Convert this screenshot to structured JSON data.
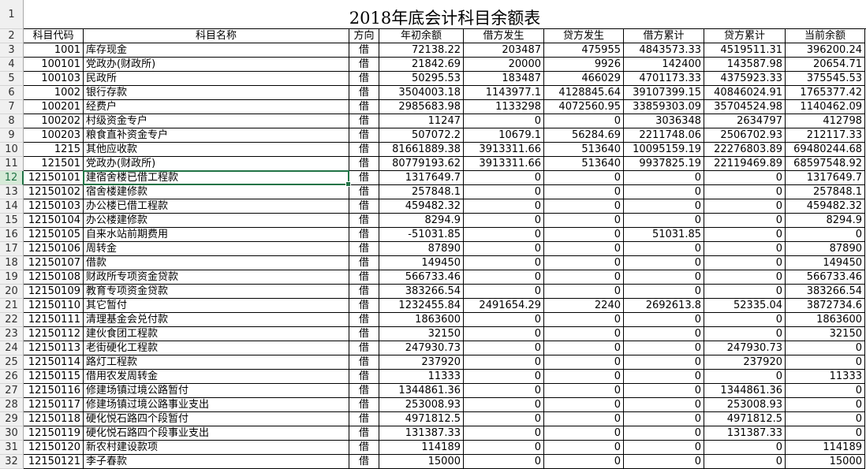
{
  "title": "2018年底会计科目余额表",
  "headers": [
    "科目代码",
    "科目名称",
    "方向",
    "年初余额",
    "借方发生",
    "贷方发生",
    "借方累计",
    "贷方累计",
    "当前余额"
  ],
  "row_numbers": [
    "1",
    "2",
    "3",
    "4",
    "5",
    "6",
    "7",
    "8",
    "9",
    "10",
    "11",
    "12",
    "13",
    "14",
    "15",
    "16",
    "17",
    "18",
    "19",
    "20",
    "21",
    "22",
    "23",
    "24",
    "25",
    "26",
    "27",
    "28",
    "29",
    "30",
    "31",
    "32"
  ],
  "selected_row": "12",
  "rows": [
    [
      "1001",
      "库存现金",
      "借",
      "72138.22",
      "203487",
      "475955",
      "4843573.33",
      "4519511.31",
      "396200.24"
    ],
    [
      "100101",
      "党政办(财政所)",
      "借",
      "21842.69",
      "20000",
      "9926",
      "142400",
      "143587.98",
      "20654.71"
    ],
    [
      "100103",
      "民政所",
      "借",
      "50295.53",
      "183487",
      "466029",
      "4701173.33",
      "4375923.33",
      "375545.53"
    ],
    [
      "1002",
      "银行存款",
      "借",
      "3504003.18",
      "1143977.1",
      "4128845.64",
      "39107399.15",
      "40846024.91",
      "1765377.42"
    ],
    [
      "100201",
      "经费户",
      "借",
      "2985683.98",
      "1133298",
      "4072560.95",
      "33859303.09",
      "35704524.98",
      "1140462.09"
    ],
    [
      "100202",
      "村级资金专户",
      "借",
      "11247",
      "0",
      "0",
      "3036348",
      "2634797",
      "412798"
    ],
    [
      "100203",
      "粮食直补资金专户",
      "借",
      "507072.2",
      "10679.1",
      "56284.69",
      "2211748.06",
      "2506702.93",
      "212117.33"
    ],
    [
      "1215",
      "其他应收款",
      "借",
      "81661889.38",
      "3913311.66",
      "513640",
      "10095159.19",
      "22276803.89",
      "69480244.68"
    ],
    [
      "121501",
      "党政办(财政所)",
      "借",
      "80779193.62",
      "3913311.66",
      "513640",
      "9937825.19",
      "22119469.89",
      "68597548.92"
    ],
    [
      "12150101",
      "建宿舍楼已借工程款",
      "借",
      "1317649.7",
      "0",
      "0",
      "0",
      "0",
      "1317649.7"
    ],
    [
      "12150102",
      "宿舍楼建修款",
      "借",
      "257848.1",
      "0",
      "0",
      "0",
      "0",
      "257848.1"
    ],
    [
      "12150103",
      "办公楼已借工程款",
      "借",
      "459482.32",
      "0",
      "0",
      "0",
      "0",
      "459482.32"
    ],
    [
      "12150104",
      "办公楼建修款",
      "借",
      "8294.9",
      "0",
      "0",
      "0",
      "0",
      "8294.9"
    ],
    [
      "12150105",
      "自来水站前期费用",
      "借",
      "-51031.85",
      "0",
      "0",
      "51031.85",
      "0",
      "0"
    ],
    [
      "12150106",
      "周转金",
      "借",
      "87890",
      "0",
      "0",
      "0",
      "0",
      "87890"
    ],
    [
      "12150107",
      "借款",
      "借",
      "149450",
      "0",
      "0",
      "0",
      "0",
      "149450"
    ],
    [
      "12150108",
      "财政所专项资金贷款",
      "借",
      "566733.46",
      "0",
      "0",
      "0",
      "0",
      "566733.46"
    ],
    [
      "12150109",
      "教育专项资金贷款",
      "借",
      "383266.54",
      "0",
      "0",
      "0",
      "0",
      "383266.54"
    ],
    [
      "12150110",
      "其它暂付",
      "借",
      "1232455.84",
      "2491654.29",
      "2240",
      "2692613.8",
      "52335.04",
      "3872734.6"
    ],
    [
      "12150111",
      "清理基金会兑付款",
      "借",
      "1863600",
      "0",
      "0",
      "0",
      "0",
      "1863600"
    ],
    [
      "12150112",
      "建伙食团工程款",
      "借",
      "32150",
      "0",
      "0",
      "0",
      "0",
      "32150"
    ],
    [
      "12150113",
      "老街硬化工程款",
      "借",
      "247930.73",
      "0",
      "0",
      "0",
      "247930.73",
      "0"
    ],
    [
      "12150114",
      "路灯工程款",
      "借",
      "237920",
      "0",
      "0",
      "0",
      "237920",
      "0"
    ],
    [
      "12150115",
      "借用农发周转金",
      "借",
      "11333",
      "0",
      "0",
      "0",
      "0",
      "11333"
    ],
    [
      "12150116",
      "修建场镇过境公路暂付",
      "借",
      "1344861.36",
      "0",
      "0",
      "0",
      "1344861.36",
      "0"
    ],
    [
      "12150117",
      "修建场镇过境公路事业支出",
      "借",
      "253008.93",
      "0",
      "0",
      "0",
      "253008.93",
      "0"
    ],
    [
      "12150118",
      "硬化悦石路四个段暂付",
      "借",
      "4971812.5",
      "0",
      "0",
      "0",
      "4971812.5",
      "0"
    ],
    [
      "12150119",
      "硬化悦石路四个段事业支出",
      "借",
      "131387.33",
      "0",
      "0",
      "0",
      "131387.33",
      "0"
    ],
    [
      "12150120",
      "新农村建设款项",
      "借",
      "114189",
      "0",
      "0",
      "0",
      "0",
      "114189"
    ],
    [
      "12150121",
      "李子春款",
      "借",
      "15000",
      "0",
      "0",
      "0",
      "0",
      "15000"
    ]
  ]
}
